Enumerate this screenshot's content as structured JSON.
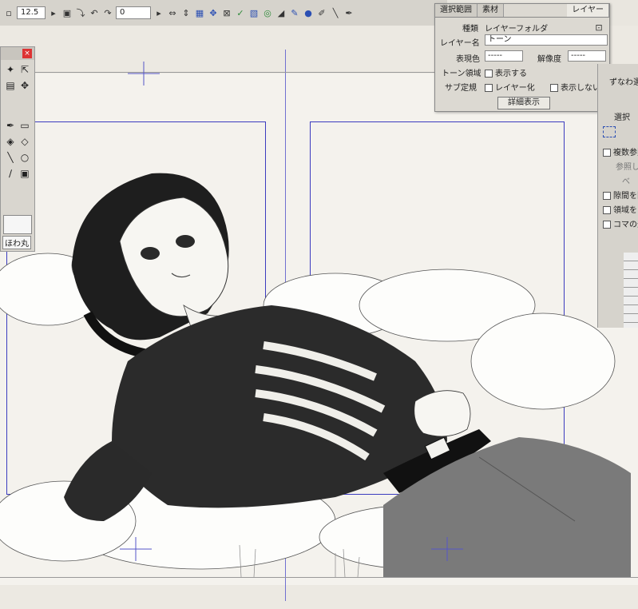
{
  "toolbar": {
    "zoom_value": "12.5",
    "rotate_value": "0"
  },
  "tools_panel": {
    "brush_label": "ほわ丸"
  },
  "layer_panel": {
    "tabs": [
      "選択範囲",
      "素材",
      "レイヤー"
    ],
    "type_label": "種類",
    "type_value": "レイヤーフォルダ",
    "name_label": "レイヤー名",
    "name_value": "トーン",
    "color_label": "表現色",
    "color_value": "-----",
    "resolution_label": "解像度",
    "resolution_value": "-----",
    "tone_area_label": "トーン領域",
    "tone_area_option": "表示する",
    "sub_ruler_label": "サブ定規",
    "sub_ruler_option1": "レイヤー化",
    "sub_ruler_option2": "表示しない",
    "detail_button": "詳細表示"
  },
  "right_panel": {
    "items": [
      "ずなわ選択",
      "選択",
      "複数参照",
      "参照し",
      "べ",
      "隙間を閉",
      "領域を",
      "コマの外"
    ]
  },
  "colors": {
    "frame_blue": "#3b3bbf",
    "panel_bg": "#dcd9d2",
    "close_red": "#dd3333"
  }
}
